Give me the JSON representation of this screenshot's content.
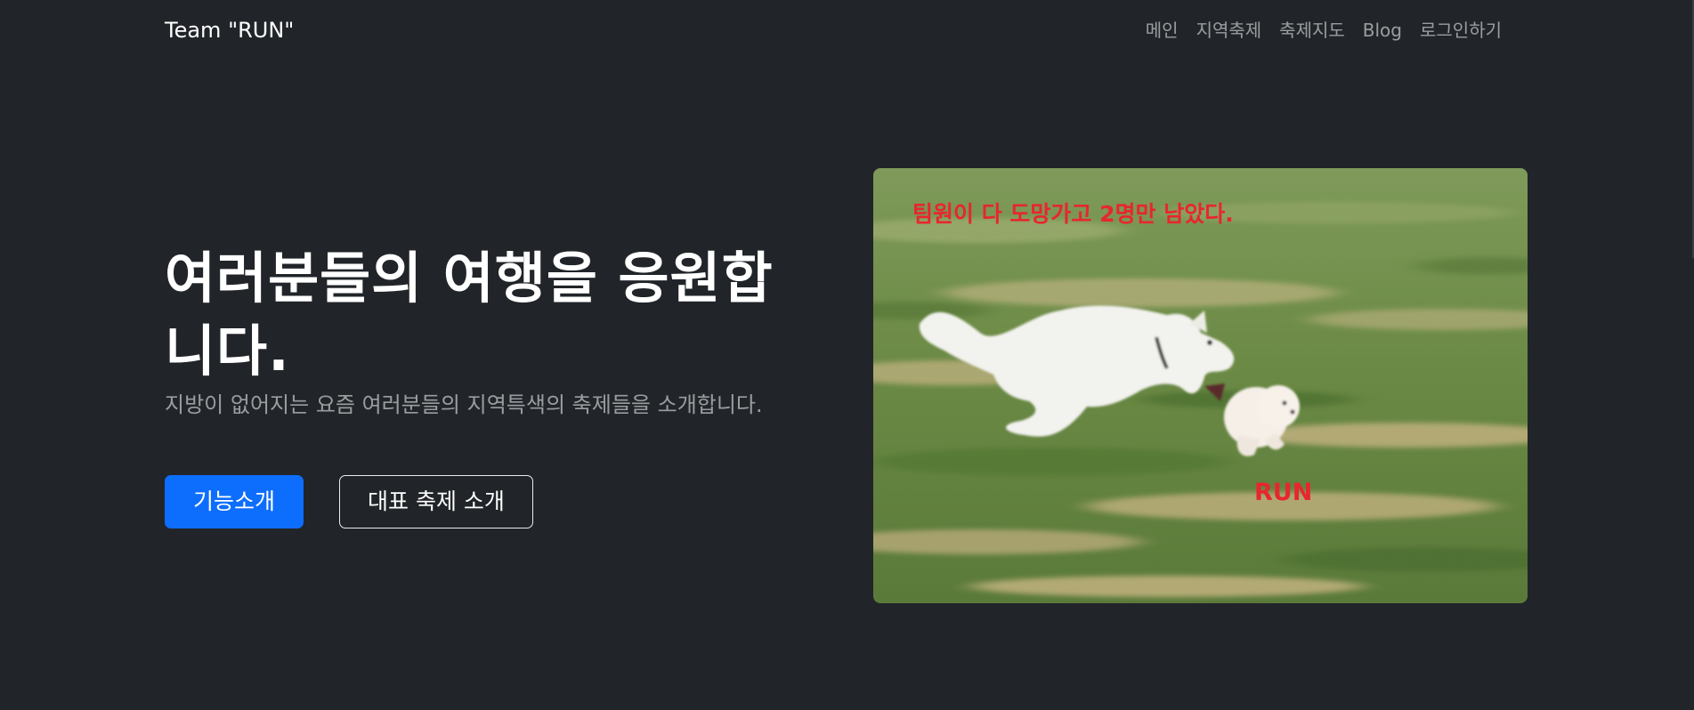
{
  "navbar": {
    "brand": "Team \"RUN\"",
    "links": [
      "메인",
      "지역축제",
      "축제지도",
      "Blog",
      "로그인하기"
    ]
  },
  "hero": {
    "title": "여러분들의 여행을 응원합니다.",
    "subtitle": "지방이 없어지는 요즘 여러분들의 지역특색의 축제들을 소개합니다.",
    "primary_button": "기능소개",
    "secondary_button": "대표 축제 소개"
  },
  "image": {
    "caption_top": "팀원이 다 도망가고 2명만 남았다.",
    "caption_run": "RUN"
  },
  "colors": {
    "background": "#212529",
    "primary": "#0d6efd",
    "caption": "#e8262d"
  }
}
